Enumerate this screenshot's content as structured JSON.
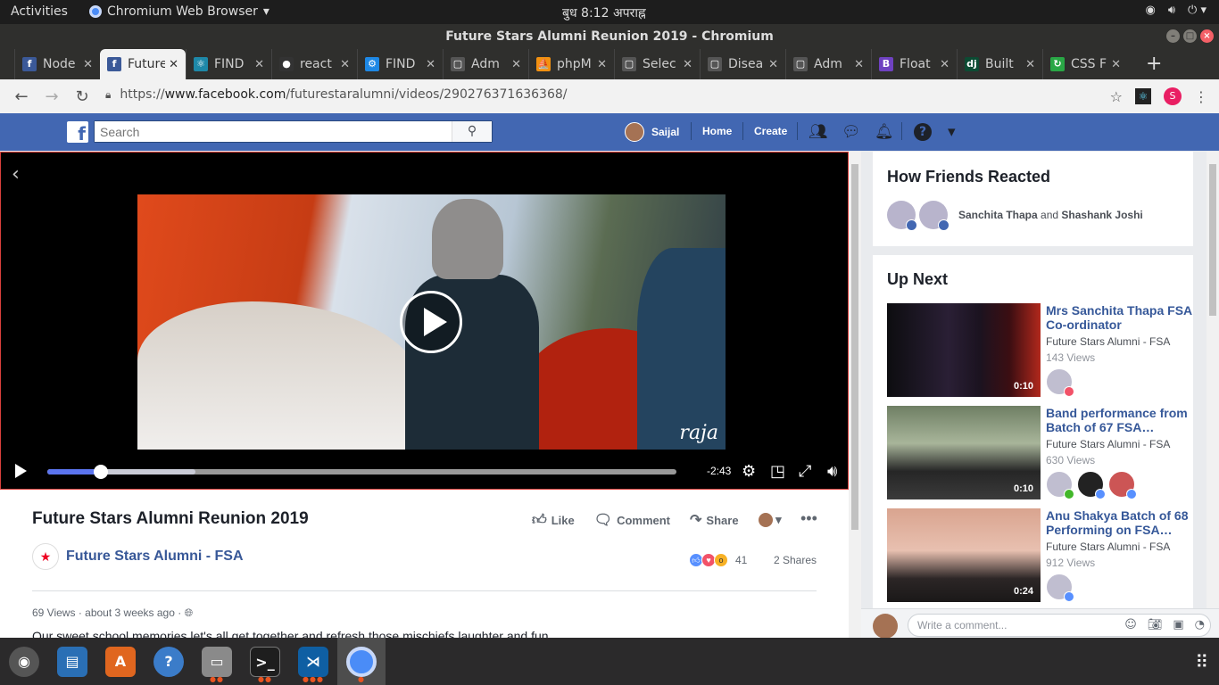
{
  "os": {
    "activities": "Activities",
    "app_name": "Chromium Web Browser",
    "clock": "बुध    8:12 अपराह्न"
  },
  "window": {
    "title": "Future Stars Alumni Reunion 2019 - Chromium"
  },
  "tabs": [
    {
      "label": "Node",
      "color": "#3b5998",
      "icon": "f"
    },
    {
      "label": "Future",
      "color": "#3b5998",
      "icon": "f"
    },
    {
      "label": "FIND",
      "color": "#1e88a8",
      "icon": "⚛"
    },
    {
      "label": "react",
      "color": "#333",
      "icon": "●"
    },
    {
      "label": "FIND",
      "color": "#1e88e5",
      "icon": "⚙"
    },
    {
      "label": "Adm",
      "color": "#555",
      "icon": "▢"
    },
    {
      "label": "phpM",
      "color": "#f29111",
      "icon": "⛵"
    },
    {
      "label": "Selec",
      "color": "#555",
      "icon": "▢"
    },
    {
      "label": "Disea",
      "color": "#555",
      "icon": "▢"
    },
    {
      "label": "Adm",
      "color": "#555",
      "icon": "▢"
    },
    {
      "label": "Float",
      "color": "#6f42c1",
      "icon": "B"
    },
    {
      "label": "Built",
      "color": "#0c4b33",
      "icon": "dj"
    },
    {
      "label": "CSS F",
      "color": "#29a745",
      "icon": "↻"
    }
  ],
  "address": {
    "scheme": "https://",
    "host": "www.facebook.com",
    "path": "/futurestaralumni/videos/290276371636368/"
  },
  "profile_initial": "S",
  "fb": {
    "logo": "f",
    "search_placeholder": "Search",
    "user": "Saijal",
    "home": "Home",
    "create": "Create"
  },
  "video": {
    "remaining": "-2:43",
    "progress": 0.085,
    "buffered": 0.235,
    "signature": "raja"
  },
  "post": {
    "title": "Future Stars Alumni Reunion 2019",
    "like": "Like",
    "comment": "Comment",
    "share": "Share",
    "page": "Future Stars Alumni - FSA",
    "reactions": "41",
    "shares": "2 Shares",
    "views": "69 Views",
    "time": "about 3 weeks ago",
    "description": "Our sweet school memories let's all get together and refresh those mischiefs laughter and fun"
  },
  "friends": {
    "heading": "How Friends Reacted",
    "name1": "Sanchita Thapa",
    "and": " and ",
    "name2": "Shashank Joshi"
  },
  "upnext": {
    "heading": "Up Next",
    "items": [
      {
        "title": "Mrs Sanchita Thapa FSA Co-ordinator",
        "source": "Future Stars Alumni - FSA",
        "views": "143 Views",
        "duration": "0:10"
      },
      {
        "title": "Band performance from Batch of 67 FSA…",
        "source": "Future Stars Alumni - FSA",
        "views": "630 Views",
        "duration": "0:10"
      },
      {
        "title": "Anu Shakya Batch of 68 Performing on FSA…",
        "source": "Future Stars Alumni - FSA",
        "views": "912 Views",
        "duration": "0:24"
      }
    ]
  },
  "comment": {
    "placeholder": "Write a comment..."
  }
}
